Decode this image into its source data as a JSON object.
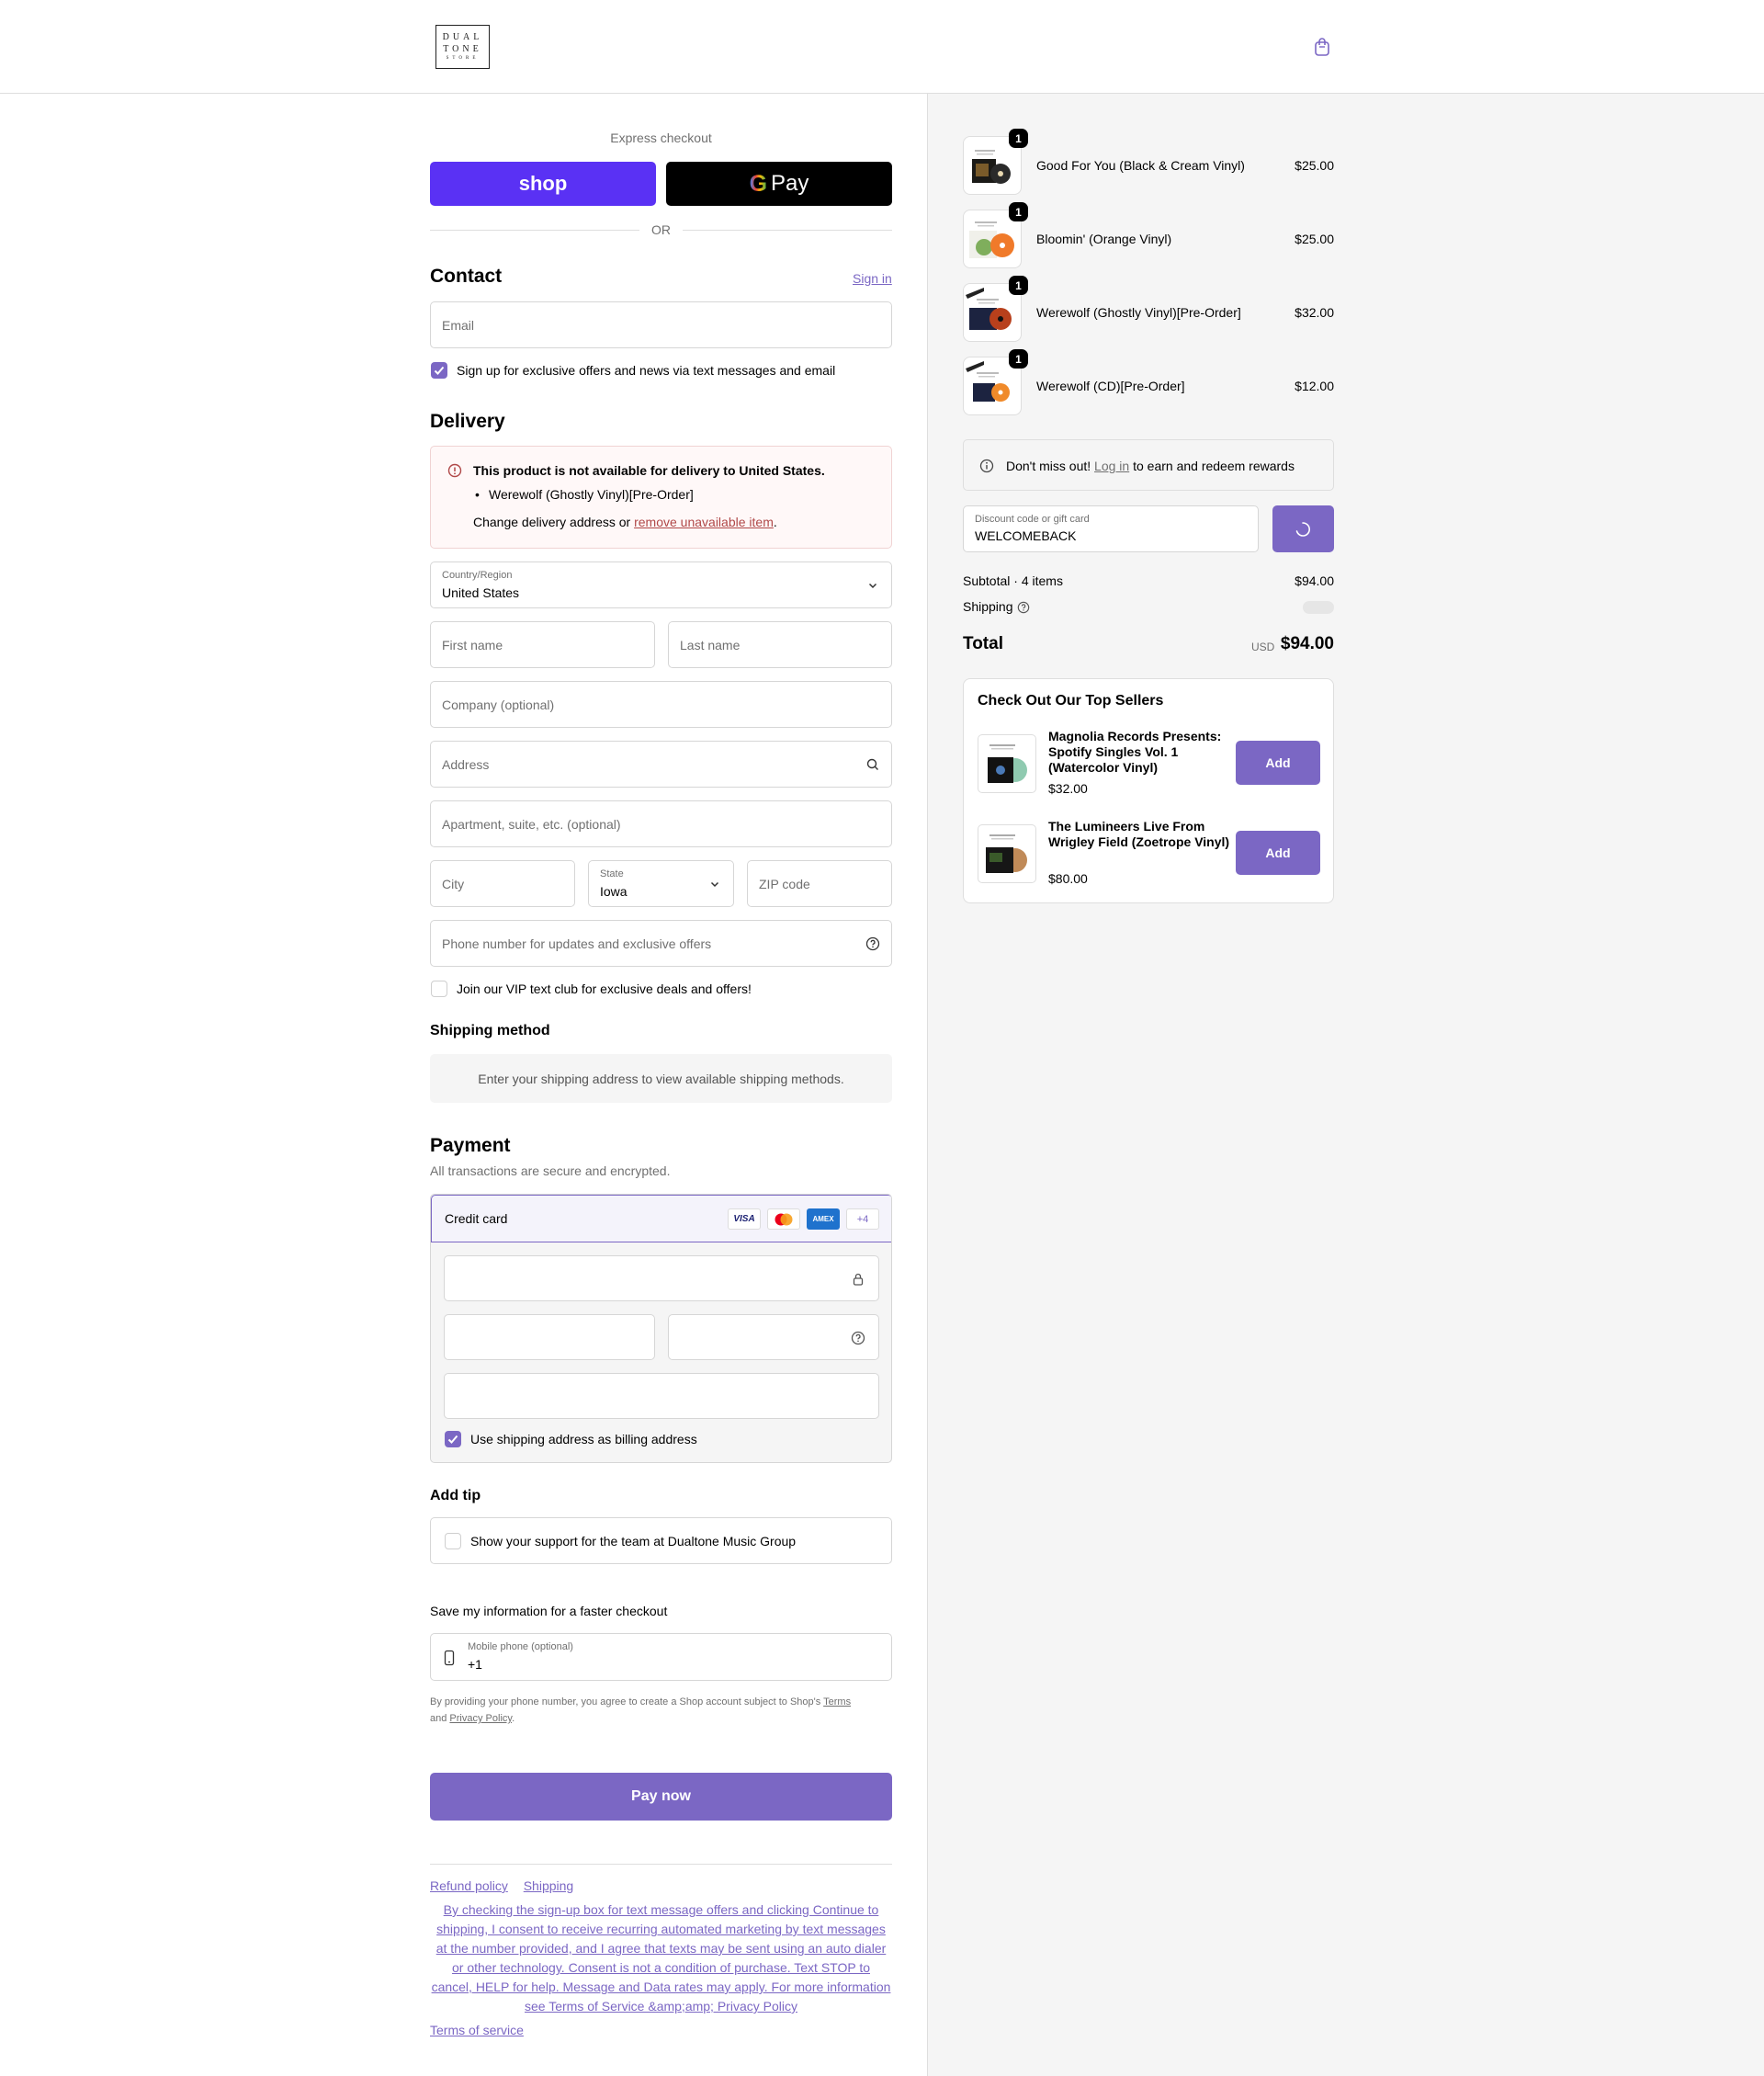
{
  "header": {
    "logo_lines": [
      "DUAL",
      "TONE",
      "STORE"
    ],
    "cart_icon": "shopping-bag-icon"
  },
  "express": {
    "title": "Express checkout",
    "shop_label": "shop",
    "gpay_g": "G",
    "gpay_label": "Pay",
    "or_label": "OR"
  },
  "contact": {
    "heading": "Contact",
    "signin": "Sign in",
    "email_placeholder": "Email",
    "signup_label": "Sign up for exclusive offers and news via text messages and email",
    "signup_checked": true
  },
  "delivery": {
    "heading": "Delivery",
    "warning_title": "This product is not available for delivery to United States.",
    "warning_item": "Werewolf (Ghostly Vinyl)[Pre-Order]",
    "warning_change_prefix": "Change delivery address or ",
    "warning_change_link": "remove unavailable item",
    "warning_change_suffix": ".",
    "country_label": "Country/Region",
    "country_value": "United States",
    "first_name": "First name",
    "last_name": "Last name",
    "company": "Company (optional)",
    "address": "Address",
    "apartment": "Apartment, suite, etc. (optional)",
    "city": "City",
    "state_label": "State",
    "state_value": "Iowa",
    "zip": "ZIP code",
    "phone": "Phone number for updates and exclusive offers",
    "vip_label": "Join our VIP text club for exclusive deals and offers!"
  },
  "shipping_method": {
    "heading": "Shipping method",
    "info": "Enter your shipping address to view available shipping methods."
  },
  "payment": {
    "heading": "Payment",
    "subtitle": "All transactions are secure and encrypted.",
    "method": "Credit card",
    "card_logos": [
      "VISA",
      "",
      "AMEX",
      "+4"
    ],
    "billing_label": "Use shipping address as billing address"
  },
  "tip": {
    "heading": "Add tip",
    "label": "Show your support for the team at Dualtone Music Group"
  },
  "save_info": {
    "heading": "Save my information for a faster checkout",
    "mobile_label": "Mobile phone (optional)",
    "mobile_value": "+1",
    "disclaimer_1": "By providing your phone number, you agree to create a Shop account subject to Shop's ",
    "terms": "Terms",
    "disclaimer_and": "and ",
    "privacy": "Privacy Policy",
    "disclaimer_end": "."
  },
  "pay_now": "Pay now",
  "footer": {
    "refund": "Refund policy",
    "shipping": "Shipping",
    "consent": "By checking the sign-up box for text message offers and clicking Continue to shipping, I consent to receive recurring automated marketing by text messages at the number provided, and I agree that texts may be sent using an auto dialer or other technology. Consent is not a condition of purchase. Text STOP to cancel, HELP for help. Message and Data rates may apply. For more information see Terms of Service &amp;amp; Privacy Policy",
    "tos": "Terms of service"
  },
  "order": {
    "items": [
      {
        "name": "Good For You (Black & Cream Vinyl)",
        "price": "$25.00",
        "qty": "1"
      },
      {
        "name": "Bloomin' (Orange Vinyl)",
        "price": "$25.00",
        "qty": "1"
      },
      {
        "name": "Werewolf (Ghostly Vinyl)[Pre-Order]",
        "price": "$32.00",
        "qty": "1"
      },
      {
        "name": "Werewolf (CD)[Pre-Order]",
        "price": "$12.00",
        "qty": "1"
      }
    ],
    "rewards_prefix": "Don't miss out! ",
    "rewards_link": "Log in",
    "rewards_suffix": " to earn and redeem rewards",
    "discount_label": "Discount code or gift card",
    "discount_value": "WELCOMEBACK",
    "subtotal_label": "Subtotal · 4 items",
    "subtotal_value": "$94.00",
    "shipping_label": "Shipping",
    "total_label": "Total",
    "total_currency": "USD",
    "total_value": "$94.00"
  },
  "upsell": {
    "heading": "Check Out Our Top Sellers",
    "add_label": "Add",
    "items": [
      {
        "name": "Magnolia Records Presents: Spotify Singles Vol. 1 (Watercolor Vinyl)",
        "price": "$32.00"
      },
      {
        "name": "The Lumineers Live From Wrigley Field (Zoetrope Vinyl)",
        "price": "$80.00"
      }
    ]
  },
  "colors": {
    "accent": "#7b67c4",
    "shop_pay": "#5a31f4",
    "error": "#b04848"
  }
}
